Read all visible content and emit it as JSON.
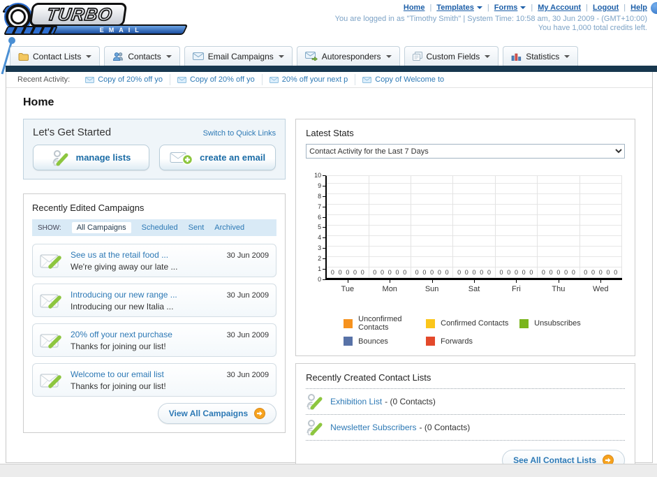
{
  "brand": {
    "name": "TURBO",
    "sub": "EMAIL"
  },
  "topnav": {
    "items": [
      {
        "label": "Home",
        "dropdown": false
      },
      {
        "label": "Templates",
        "dropdown": true
      },
      {
        "label": "Forms",
        "dropdown": true
      },
      {
        "label": "My Account",
        "dropdown": false
      },
      {
        "label": "Logout",
        "dropdown": false
      },
      {
        "label": "Help",
        "dropdown": false
      }
    ]
  },
  "session": {
    "line1": "You are logged in as \"Timothy Smith\" | System Time: 10:58 am, 30 Jun 2009 - (GMT+10:00)",
    "line2": "You have 1,000 total credits left."
  },
  "tabs": [
    {
      "label": "Contact Lists",
      "icon": "folder-icon"
    },
    {
      "label": "Contacts",
      "icon": "contacts-icon"
    },
    {
      "label": "Email Campaigns",
      "icon": "envelope-icon"
    },
    {
      "label": "Autoresponders",
      "icon": "envelope-forward-icon"
    },
    {
      "label": "Custom Fields",
      "icon": "pages-icon"
    },
    {
      "label": "Statistics",
      "icon": "bar-chart-icon"
    }
  ],
  "recent_activity": {
    "label": "Recent Activity:",
    "items": [
      {
        "title": "Copy of 20% off yo"
      },
      {
        "title": "Copy of 20% off yo"
      },
      {
        "title": "20% off your next p"
      },
      {
        "title": "Copy of Welcome to"
      }
    ]
  },
  "page_title": "Home",
  "get_started": {
    "title": "Let's Get Started",
    "switch_link": "Switch to Quick Links",
    "manage_lists_label": "manage lists",
    "create_email_label": "create an email"
  },
  "campaigns": {
    "title": "Recently Edited Campaigns",
    "show_label": "SHOW:",
    "filters": [
      {
        "label": "All Campaigns",
        "active": true
      },
      {
        "label": "Scheduled",
        "active": false
      },
      {
        "label": "Sent",
        "active": false
      },
      {
        "label": "Archived",
        "active": false
      }
    ],
    "items": [
      {
        "title": "See us at the retail food ...",
        "subtitle": "We're giving away our late ...",
        "date": "30 Jun 2009"
      },
      {
        "title": "Introducing our new range ...",
        "subtitle": "Introducing our new Italia ...",
        "date": "30 Jun 2009"
      },
      {
        "title": "20% off your next purchase",
        "subtitle": "Thanks for joining our list!",
        "date": "30 Jun 2009"
      },
      {
        "title": "Welcome to our email list",
        "subtitle": "Thanks for joining our list!",
        "date": "30 Jun 2009"
      }
    ],
    "view_all_label": "View All Campaigns"
  },
  "stats": {
    "title": "Latest Stats",
    "range_selected": "Contact Activity for the Last 7 Days"
  },
  "chart_data": {
    "type": "bar",
    "title": "Contact Activity for the Last 7 Days",
    "categories": [
      "Tue",
      "Mon",
      "Sun",
      "Sat",
      "Fri",
      "Thu",
      "Wed"
    ],
    "series": [
      {
        "name": "Unconfirmed Contacts",
        "color": "#F6921E",
        "values": [
          0,
          0,
          0,
          0,
          0,
          0,
          0
        ]
      },
      {
        "name": "Confirmed Contacts",
        "color": "#FBC61B",
        "values": [
          0,
          0,
          0,
          0,
          0,
          0,
          0
        ]
      },
      {
        "name": "Unsubscribes",
        "color": "#7AB51D",
        "values": [
          0,
          0,
          0,
          0,
          0,
          0,
          0
        ]
      },
      {
        "name": "Bounces",
        "color": "#5872A7",
        "values": [
          0,
          0,
          0,
          0,
          0,
          0,
          0
        ]
      },
      {
        "name": "Forwards",
        "color": "#E3492B",
        "values": [
          0,
          0,
          0,
          0,
          0,
          0,
          0
        ]
      }
    ],
    "ylim": [
      0,
      10
    ],
    "grid": true,
    "legend_position": "bottom"
  },
  "contact_lists": {
    "title": "Recently Created Contact Lists",
    "items": [
      {
        "name": "Exhibition List",
        "meta": "- (0 Contacts)"
      },
      {
        "name": "Newsletter Subscribers",
        "meta": "- (0 Contacts)"
      }
    ],
    "see_all_label": "See All Contact Lists"
  },
  "colors": {
    "link_blue": "#2d79b5",
    "navy_bar": "#17374e",
    "accent_orange": "#f6a21d",
    "action_green": "#8dc63f",
    "brand_blue": "#2f6fd0"
  }
}
